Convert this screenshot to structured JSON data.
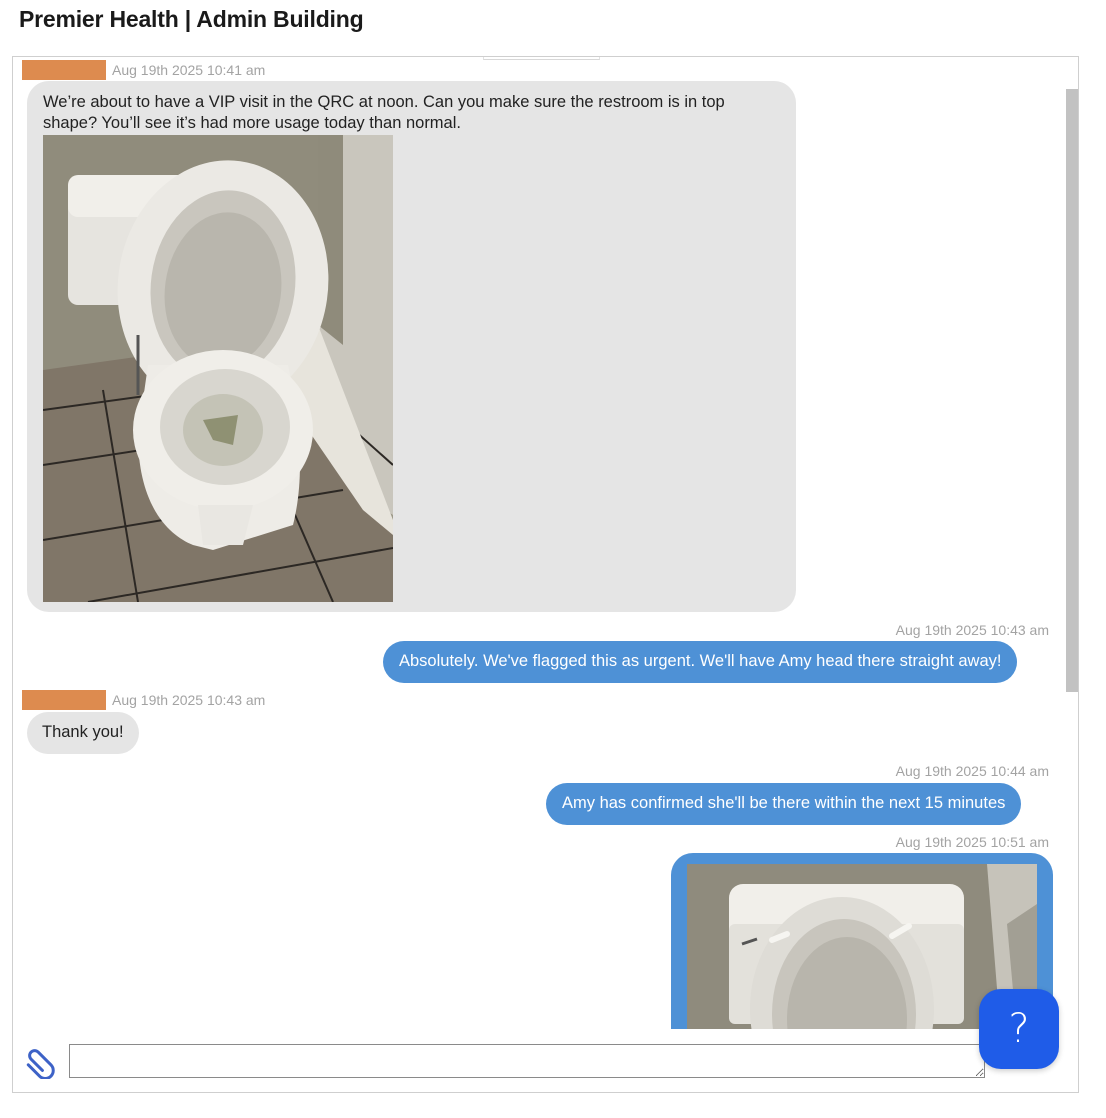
{
  "page": {
    "title": "Premier Health | Admin Building"
  },
  "messages": [
    {
      "direction": "incoming",
      "timestamp": "Aug 19th 2025 10:41 am",
      "text": "We’re about to have a VIP visit in the QRC at noon. Can you make sure the restroom is in top shape? You’ll see it’s had more usage today than normal.",
      "attachment": "photo-toilet"
    },
    {
      "direction": "outgoing",
      "timestamp": "Aug 19th 2025 10:43 am",
      "text": "Absolutely. We've flagged this as urgent. We'll have Amy head there straight away!"
    },
    {
      "direction": "incoming",
      "timestamp": "Aug 19th 2025 10:43 am",
      "text": "Thank you!"
    },
    {
      "direction": "outgoing",
      "timestamp": "Aug 19th 2025 10:44 am",
      "text": "Amy has confirmed she'll be there within the next 15 minutes"
    },
    {
      "direction": "outgoing",
      "timestamp": "Aug 19th 2025 10:51 am",
      "attachment": "photo-toilet-cleaned"
    }
  ],
  "composer": {
    "placeholder": "",
    "attach_icon": "paperclip-icon",
    "help_icon": "question-mark-icon",
    "help_label": "?"
  },
  "colors": {
    "incoming_bubble": "#e5e5e5",
    "outgoing_bubble": "#4e91d6",
    "sender_tag": "#dd8b4f",
    "help_button": "#1f5ce8",
    "timestamp": "#a3a3a3"
  }
}
